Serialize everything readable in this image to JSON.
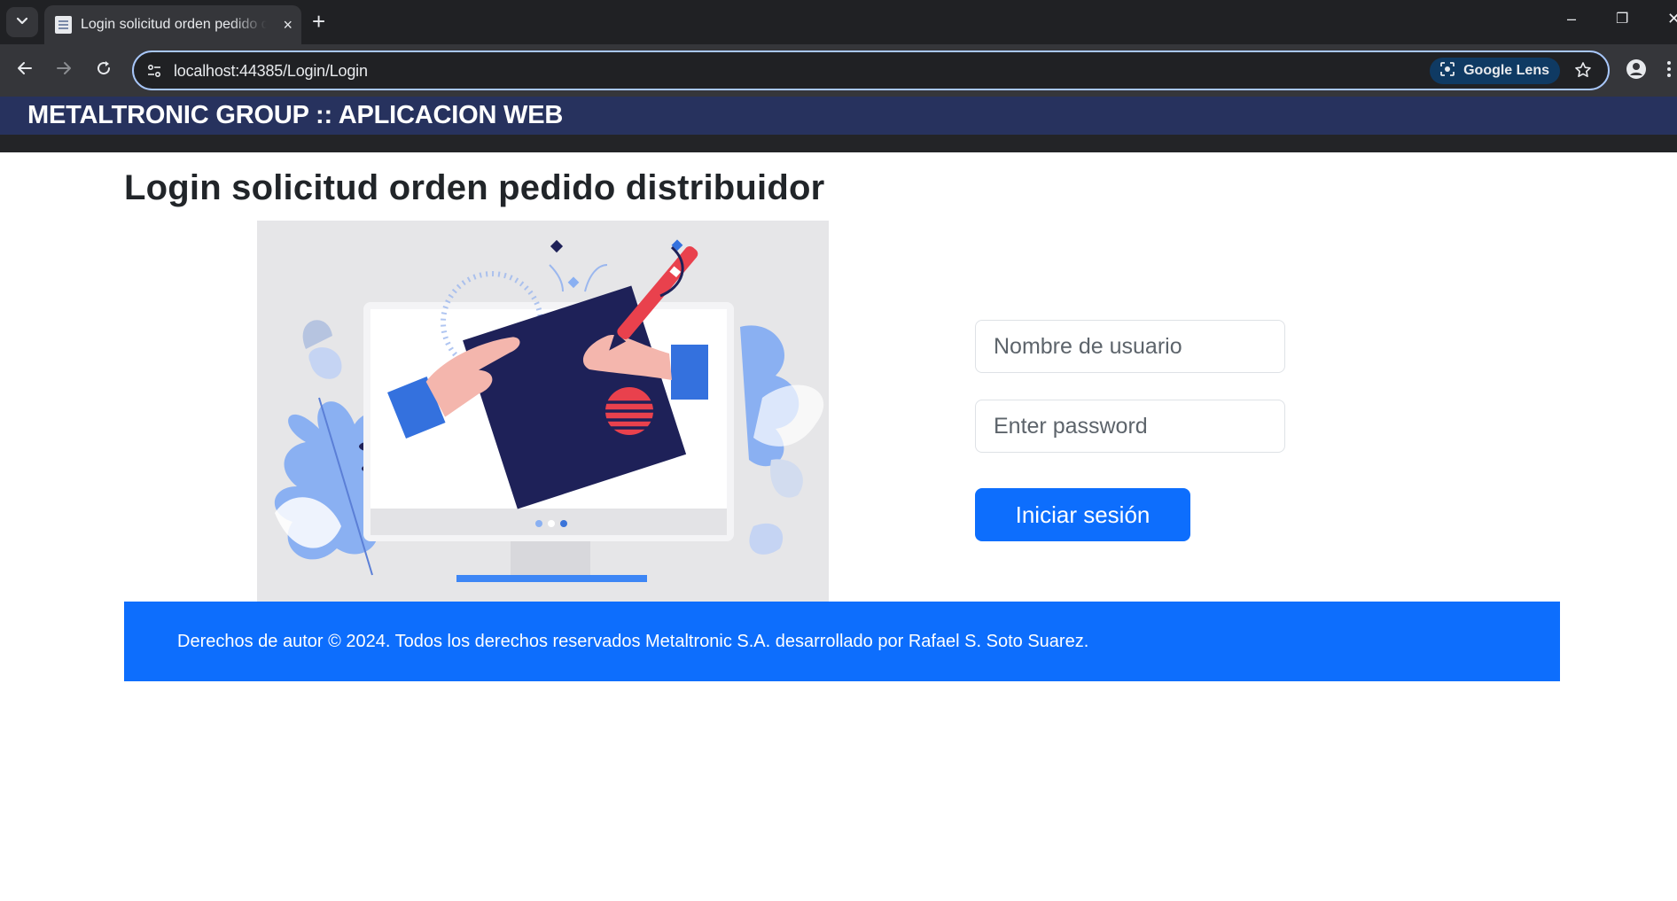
{
  "browser": {
    "tab_title": "Login solicitud orden pedido distribuidor",
    "tab_close": "×",
    "new_tab": "+",
    "url": "localhost:44385/Login/Login",
    "lens_label": "Google Lens",
    "window_controls": {
      "minimize": "–",
      "restore": "❐",
      "close": "✕"
    },
    "icons": [
      "tab-search-icon",
      "page-favicon-icon",
      "back-arrow-icon",
      "forward-arrow-icon",
      "reload-icon",
      "site-info-icon",
      "google-lens-icon",
      "star-icon",
      "profile-icon",
      "kebab-menu-icon"
    ]
  },
  "header": {
    "title": "METALTRONIC GROUP :: APLICACION WEB",
    "background": "#27325e"
  },
  "page": {
    "heading": "Login solicitud orden pedido distribuidor"
  },
  "form": {
    "username_placeholder": "Nombre de usuario",
    "password_placeholder": "Enter password",
    "submit_label": "Iniciar sesión",
    "accent": "#0d6efd"
  },
  "footer": {
    "text": "Derechos de autor © 2024. Todos los derechos reservados Metaltronic S.A. desarrollado por Rafael S. Soto Suarez.",
    "background": "#0d6efd"
  }
}
